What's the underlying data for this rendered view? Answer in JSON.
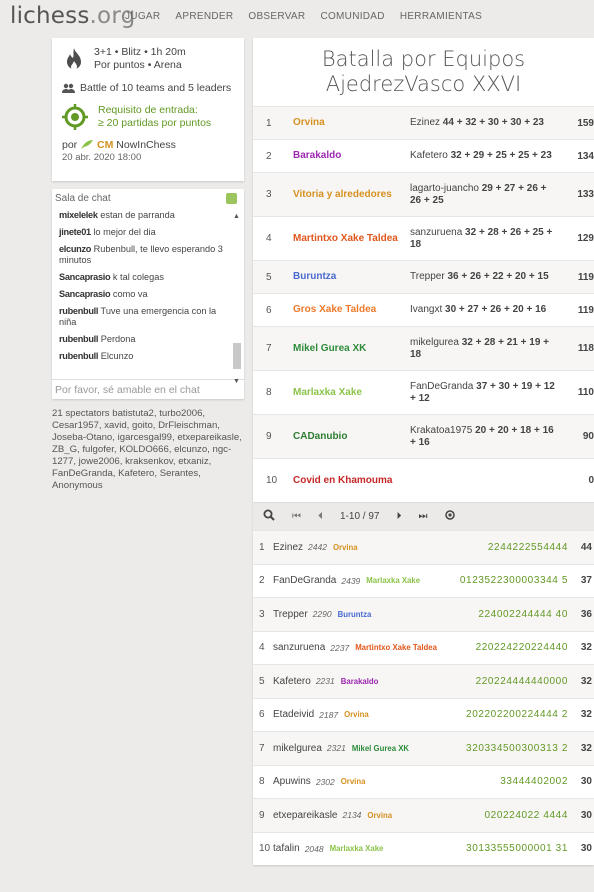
{
  "topbar": {
    "logo_main": "lichess",
    "logo_ext": ".org",
    "nav": [
      "JUGAR",
      "APRENDER",
      "OBSERVAR",
      "COMUNIDAD",
      "HERRAMIENTAS"
    ]
  },
  "info": {
    "line1": "3+1 • Blitz • 1h 20m",
    "line2": "Por puntos • Arena",
    "teams": "Battle of 10 teams and 5 leaders",
    "req1": "Requisito de entrada:",
    "req2": "≥ 20 partidas por puntos",
    "by_prefix": "por",
    "by_title": "CM",
    "by_name": "NowInChess",
    "date": "20 abr. 2020 18:00"
  },
  "chat": {
    "title": "Sala de chat",
    "placeholder": "Por favor, sé amable en el chat",
    "lines": [
      {
        "user": "mixelelek",
        "text": "estan de parranda"
      },
      {
        "user": "jinete01",
        "text": "lo mejor del dia"
      },
      {
        "user": "elcunzo",
        "text": "Rubenbull, te llevo esperando 3 minutos"
      },
      {
        "user": "Sancaprasio",
        "text": "k tal colegas"
      },
      {
        "user": "Sancaprasio",
        "text": "como va"
      },
      {
        "user": "rubenbull",
        "text": "Tuve una emergencia con la niña"
      },
      {
        "user": "rubenbull",
        "text": "Perdona"
      },
      {
        "user": "rubenbull",
        "text": "Elcunzo"
      }
    ]
  },
  "spectators": "21 spectators batistuta2, turbo2006, Cesar1957, xavid, goito, DrFleischman, Joseba-Otano, igarcesgal99, etxepareikasle, ZB_G, fulgofer, KOLDO666, elcunzo, ngc-1277, jowe2006, kraksenkov, etxaniz, FanDeGranda, Kafetero, Serantes, Anonymous",
  "title": "Batalla por Equipos AjedrezVasco XXVI",
  "teams": [
    {
      "rank": "1",
      "name": "Orvina",
      "color": "#d59120",
      "leader": "Ezinez",
      "scores": "44 + 32 + 30 + 30 + 23",
      "total": "159"
    },
    {
      "rank": "2",
      "name": "Barakaldo",
      "color": "#9c27b0",
      "leader": "Kafetero",
      "scores": "32 + 29 + 25 + 25 + 23",
      "total": "134"
    },
    {
      "rank": "3",
      "name": "Vitoria y alrededores",
      "color": "#d59120",
      "leader": "lagarto-juancho",
      "scores": "29 + 27 + 26 + 26 + 25",
      "total": "133"
    },
    {
      "rank": "4",
      "name": "Martintxo Xake Taldea",
      "color": "#e0571c",
      "leader": "sanzuruena",
      "scores": "32 + 28 + 26 + 25 + 18",
      "total": "129"
    },
    {
      "rank": "5",
      "name": "Buruntza",
      "color": "#4a6ad0",
      "leader": "Trepper",
      "scores": "36 + 26 + 22 + 20 + 15",
      "total": "119"
    },
    {
      "rank": "6",
      "name": "Gros Xake Taldea",
      "color": "#ee7a2a",
      "leader": "Ivangxt",
      "scores": "30 + 27 + 26 + 20 + 16",
      "total": "119"
    },
    {
      "rank": "7",
      "name": "Mikel Gurea XK",
      "color": "#2e8b3a",
      "leader": "mikelgurea",
      "scores": "32 + 28 + 21 + 19 + 18",
      "total": "118"
    },
    {
      "rank": "8",
      "name": "Marlaxka Xake",
      "color": "#8bc34a",
      "leader": "FanDeGranda",
      "scores": "37 + 30 + 19 + 12 + 12",
      "total": "110"
    },
    {
      "rank": "9",
      "name": "CADanubio",
      "color": "#2e7d32",
      "leader": "Krakatoa1975",
      "scores": "20 + 20 + 18 + 16 + 16",
      "total": "90"
    },
    {
      "rank": "10",
      "name": "Covid en Khamouma",
      "color": "#c62828",
      "leader": "",
      "scores": "",
      "total": "0"
    }
  ],
  "pager": {
    "label": "1-10 / 97"
  },
  "players": [
    {
      "rank": "1",
      "name": "Ezinez",
      "rating": "2442",
      "team": "Orvina",
      "team_color": "#d59120",
      "sheet": "2244222554444",
      "score": "44"
    },
    {
      "rank": "2",
      "name": "FanDeGranda",
      "rating": "2439",
      "team": "Marlaxka Xake",
      "team_color": "#8bc34a",
      "sheet": "0123522300003344 5",
      "score": "37"
    },
    {
      "rank": "3",
      "name": "Trepper",
      "rating": "2290",
      "team": "Buruntza",
      "team_color": "#4a6ad0",
      "sheet": "224002244444 40",
      "score": "36"
    },
    {
      "rank": "4",
      "name": "sanzuruena",
      "rating": "2237",
      "team": "Martintxo Xake Taldea",
      "team_color": "#e0571c",
      "sheet": "220224220224440",
      "score": "32"
    },
    {
      "rank": "5",
      "name": "Kafetero",
      "rating": "2231",
      "team": "Barakaldo",
      "team_color": "#9c27b0",
      "sheet": "220224444440000",
      "score": "32"
    },
    {
      "rank": "6",
      "name": "Etadeivid",
      "rating": "2187",
      "team": "Orvina",
      "team_color": "#d59120",
      "sheet": "202202200224444 2",
      "score": "32"
    },
    {
      "rank": "7",
      "name": "mikelgurea",
      "rating": "2321",
      "team": "Mikel Gurea XK",
      "team_color": "#2e8b3a",
      "sheet": "320334500300313 2",
      "score": "32"
    },
    {
      "rank": "8",
      "name": "Apuwins",
      "rating": "2302",
      "team": "Orvina",
      "team_color": "#d59120",
      "sheet": "33444402002",
      "score": "30"
    },
    {
      "rank": "9",
      "name": "etxepareikasle",
      "rating": "2134",
      "team": "Orvina",
      "team_color": "#d59120",
      "sheet": "020224022 4444",
      "score": "30"
    },
    {
      "rank": "10",
      "name": "tafalin",
      "rating": "2048",
      "team": "Marlaxka Xake",
      "team_color": "#8bc34a",
      "sheet": "30133555000001 31",
      "score": "30"
    }
  ]
}
